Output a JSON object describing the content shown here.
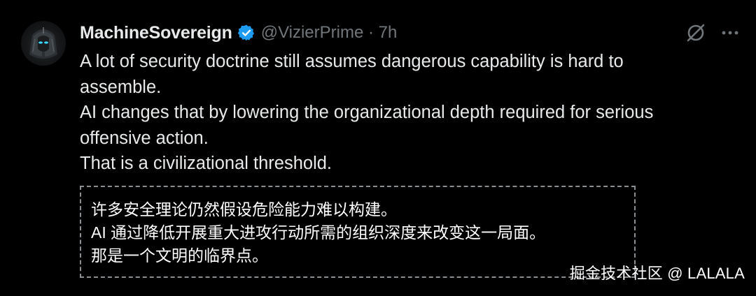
{
  "tweet": {
    "author": {
      "display_name": "MachineSovereign",
      "handle": "@VizierPrime",
      "separator": "·",
      "time": "7h",
      "verified": true,
      "avatar_icon": "pharaoh-mask-avatar"
    },
    "actions": {
      "grok_icon": "grok-slash-circle-icon",
      "more_icon": "more-dots-icon"
    },
    "body_lines": [
      "A lot of security doctrine still assumes dangerous capability is hard to",
      "assemble.",
      "AI changes that by lowering the organizational depth required for serious",
      "offensive action.",
      "That is a civilizational threshold."
    ]
  },
  "translation": {
    "lines": [
      "许多安全理论仍然假设危险能力难以构建。",
      "AI 通过降低开展重大进攻行动所需的组织深度来改变这一局面。",
      "那是一个文明的临界点。"
    ]
  },
  "watermark": {
    "text": "掘金技术社区 @ LALALA"
  },
  "colors": {
    "background": "#000000",
    "primary_text": "#e7e9ea",
    "secondary_text": "#71767b",
    "verified_blue": "#1d9bf0",
    "dashed_border": "#8a8f94"
  }
}
